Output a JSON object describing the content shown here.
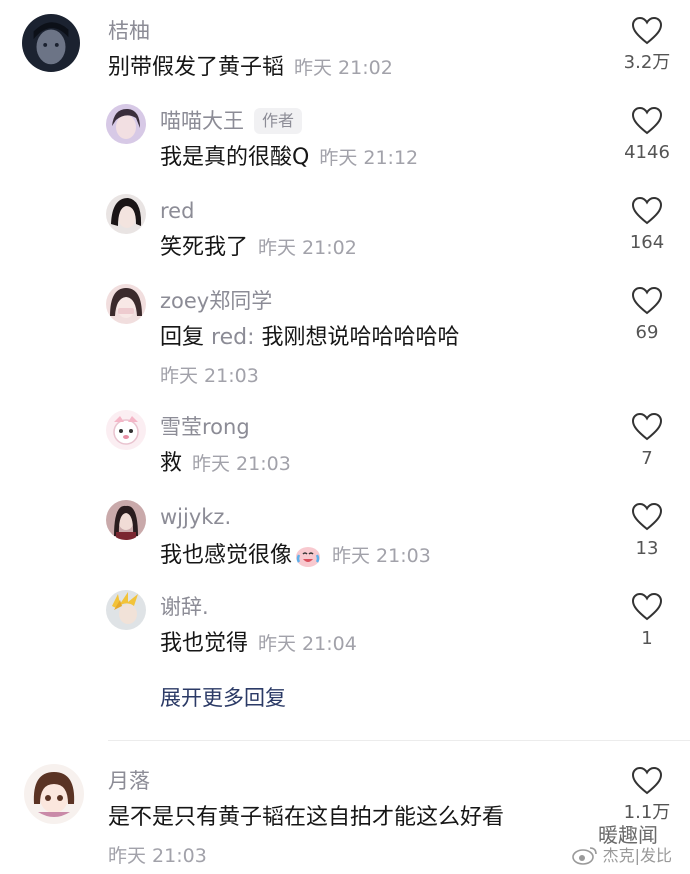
{
  "comments": [
    {
      "user": "桔柚",
      "text": "别带假发了黄子韬",
      "time": "昨天 21:02",
      "likes": "3.2万"
    },
    {
      "user": "喵喵大王",
      "badge": "作者",
      "text": "我是真的很酸Q",
      "time": "昨天 21:12",
      "likes": "4146"
    },
    {
      "user": "red",
      "text": "笑死我了",
      "time": "昨天 21:02",
      "likes": "164"
    },
    {
      "user": "zoey郑同学",
      "reply_prefix": "回复",
      "reply_target": "red:",
      "text": "我刚想说哈哈哈哈哈",
      "time": "昨天 21:03",
      "likes": "69"
    },
    {
      "user": "雪莹rong",
      "text": "救",
      "time": "昨天 21:03",
      "likes": "7"
    },
    {
      "user": "wjjykz.",
      "text": "我也感觉很像",
      "time": "昨天 21:03",
      "likes": "13"
    },
    {
      "user": "谢辞.",
      "text": "我也觉得",
      "time": "昨天 21:04",
      "likes": "1"
    },
    {
      "user": "月落",
      "text": "是不是只有黄子韬在这自拍才能这么好看",
      "time": "昨天 21:03",
      "likes": "1.1万"
    }
  ],
  "expand_replies": "展开更多回复",
  "watermark": {
    "line1": "暖趣闻",
    "line2": "杰克|发比"
  },
  "icons": {
    "like": "heart-outline-icon",
    "emoji": "crying-laugh-emoji-icon",
    "watermark_logo": "weibo-logo-icon"
  }
}
